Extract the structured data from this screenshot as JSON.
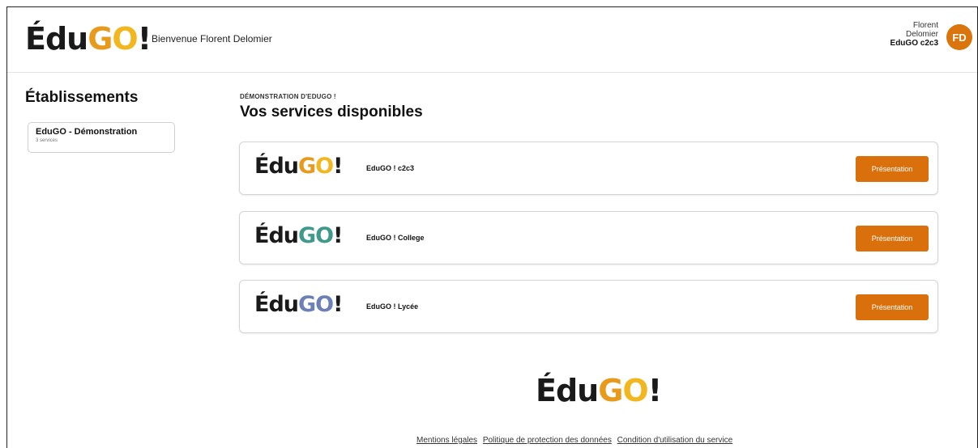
{
  "header": {
    "logo": {
      "edu": "Édu",
      "g": "G",
      "o": "O",
      "bang": "!"
    },
    "welcome": "Bienvenue Florent Delomier",
    "user": {
      "first_name": "Florent",
      "last_name": "Delomier",
      "org": "EduGO c2c3",
      "initials": "FD"
    }
  },
  "sidebar": {
    "title": "Établissements",
    "card": {
      "name": "EduGO - Démonstration",
      "sub": "3 services"
    }
  },
  "main": {
    "eyebrow": "DÉMONSTRATION D'EDUGO !",
    "title": "Vos services disponibles",
    "services": [
      {
        "logo": {
          "edu": "Édu",
          "g": "G",
          "o": "O",
          "bang": "!"
        },
        "name": "EduGO ! c2c3",
        "button": "Présentation",
        "colors": {
          "g": "#e89a1c",
          "o": "#f2b61f"
        }
      },
      {
        "logo": {
          "edu": "Édu",
          "g": "G",
          "o": "O",
          "bang": "!"
        },
        "name": "EduGO ! College",
        "button": "Présentation",
        "colors": {
          "g": "#3f9a8c",
          "o": "#3f9a8c"
        }
      },
      {
        "logo": {
          "edu": "Édu",
          "g": "G",
          "o": "O",
          "bang": "!"
        },
        "name": "EduGO ! Lycée",
        "button": "Présentation",
        "colors": {
          "g": "#6c7fb6",
          "o": "#6c7fb6"
        }
      }
    ]
  },
  "footer": {
    "logo": {
      "edu": "Édu",
      "g": "G",
      "o": "O",
      "bang": "!"
    },
    "links": [
      "Mentions légales",
      "Politique de protection des données",
      "Condition d'utilisation du service"
    ]
  },
  "colors": {
    "accent": "#d9700c",
    "logo_g": "#e89a1c",
    "logo_o": "#f2b61f"
  }
}
